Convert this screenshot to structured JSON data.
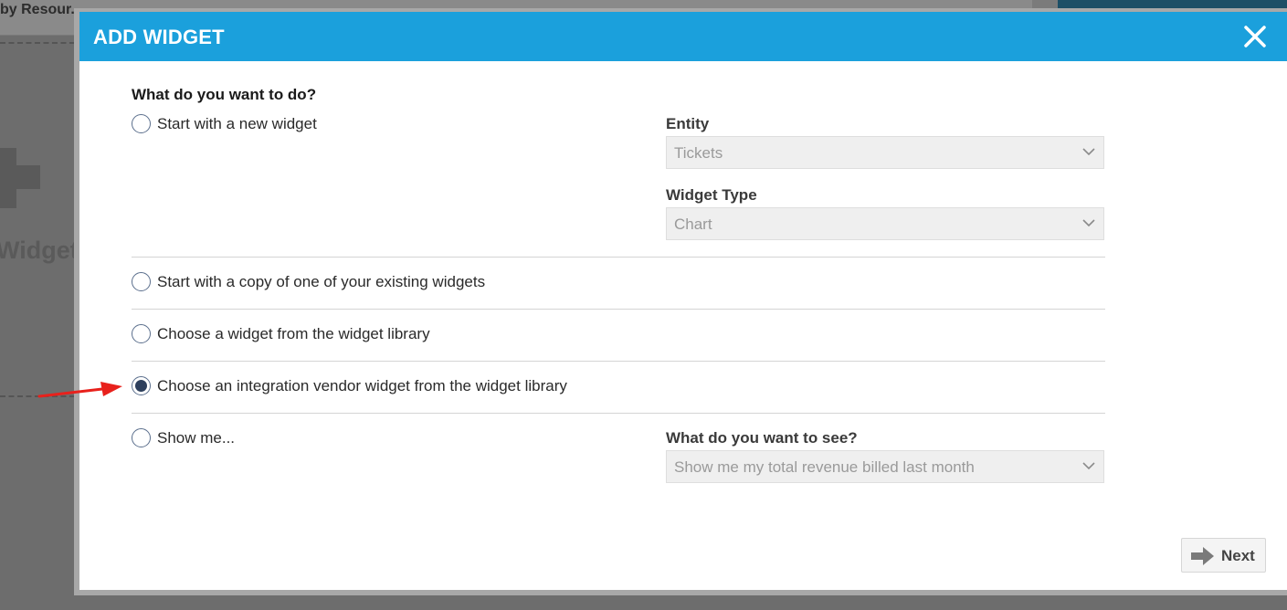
{
  "background": {
    "tabs_text": "by Resour...",
    "widget_text": "Widget"
  },
  "modal": {
    "title": "ADD WIDGET",
    "question": "What do you want to do?",
    "options": [
      {
        "label": "Start with a new widget",
        "checked": false
      },
      {
        "label": "Start with a copy of one of your existing widgets",
        "checked": false
      },
      {
        "label": "Choose a widget from the widget library",
        "checked": false
      },
      {
        "label": "Choose an integration vendor widget from the widget library",
        "checked": true
      },
      {
        "label": "Show me...",
        "checked": false
      }
    ],
    "entity": {
      "label": "Entity",
      "value": "Tickets"
    },
    "widget_type": {
      "label": "Widget Type",
      "value": "Chart"
    },
    "show_me": {
      "label": "What do you want to see?",
      "value": "Show me my total revenue billed last month"
    },
    "next_button": "Next"
  },
  "colors": {
    "header": "#1ba0dc",
    "annotation_arrow": "#e8211c"
  }
}
